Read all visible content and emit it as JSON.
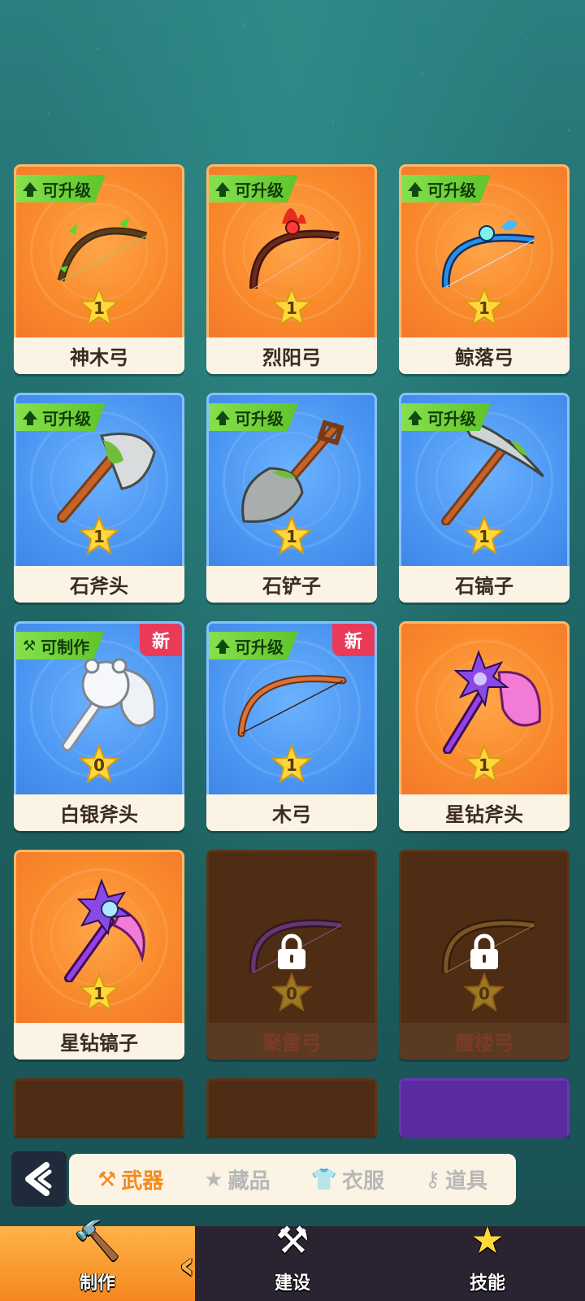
{
  "cards": [
    {
      "name": "神木弓",
      "badge": "可升级",
      "stars": "1",
      "theme": "orange",
      "new": ""
    },
    {
      "name": "烈阳弓",
      "badge": "可升级",
      "stars": "1",
      "theme": "orange",
      "new": ""
    },
    {
      "name": "鲸落弓",
      "badge": "可升级",
      "stars": "1",
      "theme": "orange",
      "new": ""
    },
    {
      "name": "石斧头",
      "badge": "可升级",
      "stars": "1",
      "theme": "blue",
      "new": ""
    },
    {
      "name": "石铲子",
      "badge": "可升级",
      "stars": "1",
      "theme": "blue",
      "new": ""
    },
    {
      "name": "石镐子",
      "badge": "可升级",
      "stars": "1",
      "theme": "blue",
      "new": ""
    },
    {
      "name": "白银斧头",
      "badge": "可制作",
      "stars": "0",
      "theme": "blue",
      "new": "新"
    },
    {
      "name": "木弓",
      "badge": "可升级",
      "stars": "1",
      "theme": "blue",
      "new": "新"
    },
    {
      "name": "星钻斧头",
      "badge": "",
      "stars": "1",
      "theme": "orange",
      "new": ""
    },
    {
      "name": "星钻镐子",
      "badge": "",
      "stars": "1",
      "theme": "orange",
      "new": ""
    },
    {
      "name": "聚雷弓",
      "badge": "",
      "stars": "0",
      "theme": "locked",
      "new": ""
    },
    {
      "name": "蜃楼弓",
      "badge": "",
      "stars": "0",
      "theme": "locked",
      "new": ""
    }
  ],
  "tabs": [
    {
      "label": "武器",
      "icon": "hammer-icon"
    },
    {
      "label": "藏品",
      "icon": "star-card-icon"
    },
    {
      "label": "衣服",
      "icon": "shirt-icon"
    },
    {
      "label": "道具",
      "icon": "key-icon"
    }
  ],
  "nav": [
    {
      "label": "制作",
      "icon": "hammer-icon"
    },
    {
      "label": "建设",
      "icon": "stone-hammer-icon"
    },
    {
      "label": "技能",
      "icon": "star-icon"
    }
  ],
  "colors": {
    "orange": "#f98a2c",
    "blue": "#4c97f3",
    "badge": "#6fd039",
    "new": "#e93b59",
    "active_tab": "#f78a1b"
  }
}
